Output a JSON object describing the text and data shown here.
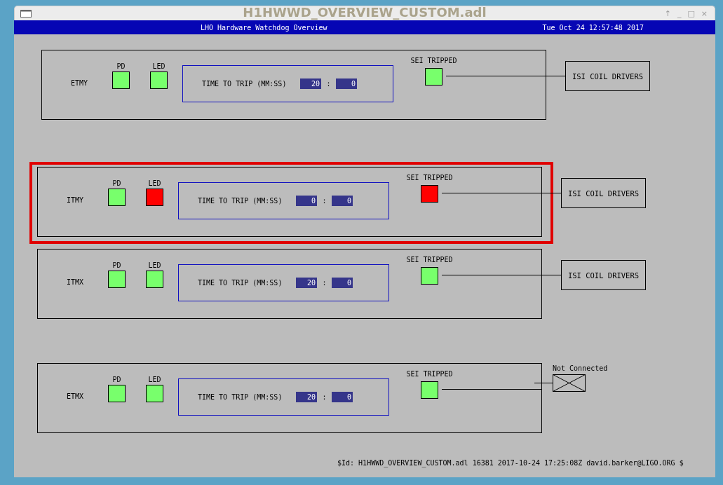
{
  "window": {
    "title": "H1HWWD_OVERVIEW_CUSTOM.adl",
    "buttons": [
      "↑",
      "_",
      "□",
      "×"
    ]
  },
  "header": {
    "title": "LHO Hardware Watchdog Overview",
    "datetime": "Tue Oct 24 12:57:48 2017"
  },
  "stations": [
    {
      "name": "ETMY",
      "highlighted": false,
      "indicators": [
        {
          "label": "PD",
          "tripped": false
        },
        {
          "label": "LED",
          "tripped": false
        }
      ],
      "timer": {
        "label": "TIME TO TRIP (MM:SS)",
        "minutes": "20",
        "separator": ":",
        "seconds": "0"
      },
      "sei": {
        "label": "SEI TRIPPED",
        "tripped": false
      },
      "output": {
        "kind": "driver",
        "label": "ISI COIL DRIVERS"
      }
    },
    {
      "name": "ITMY",
      "highlighted": true,
      "indicators": [
        {
          "label": "PD",
          "tripped": false
        },
        {
          "label": "LED",
          "tripped": true
        }
      ],
      "timer": {
        "label": "TIME TO TRIP (MM:SS)",
        "minutes": "0",
        "separator": ":",
        "seconds": "0"
      },
      "sei": {
        "label": "SEI TRIPPED",
        "tripped": true
      },
      "output": {
        "kind": "driver",
        "label": "ISI COIL DRIVERS"
      }
    },
    {
      "name": "ITMX",
      "highlighted": false,
      "indicators": [
        {
          "label": "PD",
          "tripped": false
        },
        {
          "label": "LED",
          "tripped": false
        }
      ],
      "timer": {
        "label": "TIME TO TRIP (MM:SS)",
        "minutes": "20",
        "separator": ":",
        "seconds": "0"
      },
      "sei": {
        "label": "SEI TRIPPED",
        "tripped": false
      },
      "output": {
        "kind": "driver",
        "label": "ISI COIL DRIVERS"
      }
    },
    {
      "name": "ETMX",
      "highlighted": false,
      "indicators": [
        {
          "label": "PD",
          "tripped": false
        },
        {
          "label": "LED",
          "tripped": false
        }
      ],
      "timer": {
        "label": "TIME TO TRIP (MM:SS)",
        "minutes": "20",
        "separator": ":",
        "seconds": "0"
      },
      "sei": {
        "label": "SEI TRIPPED",
        "tripped": false
      },
      "output": {
        "kind": "not_connected",
        "label": "Not Connected"
      }
    }
  ],
  "footer": "$Id: H1HWWD_OVERVIEW_CUSTOM.adl 16381 2017-10-24 17:25:08Z david.barker@LIGO.ORG $"
}
